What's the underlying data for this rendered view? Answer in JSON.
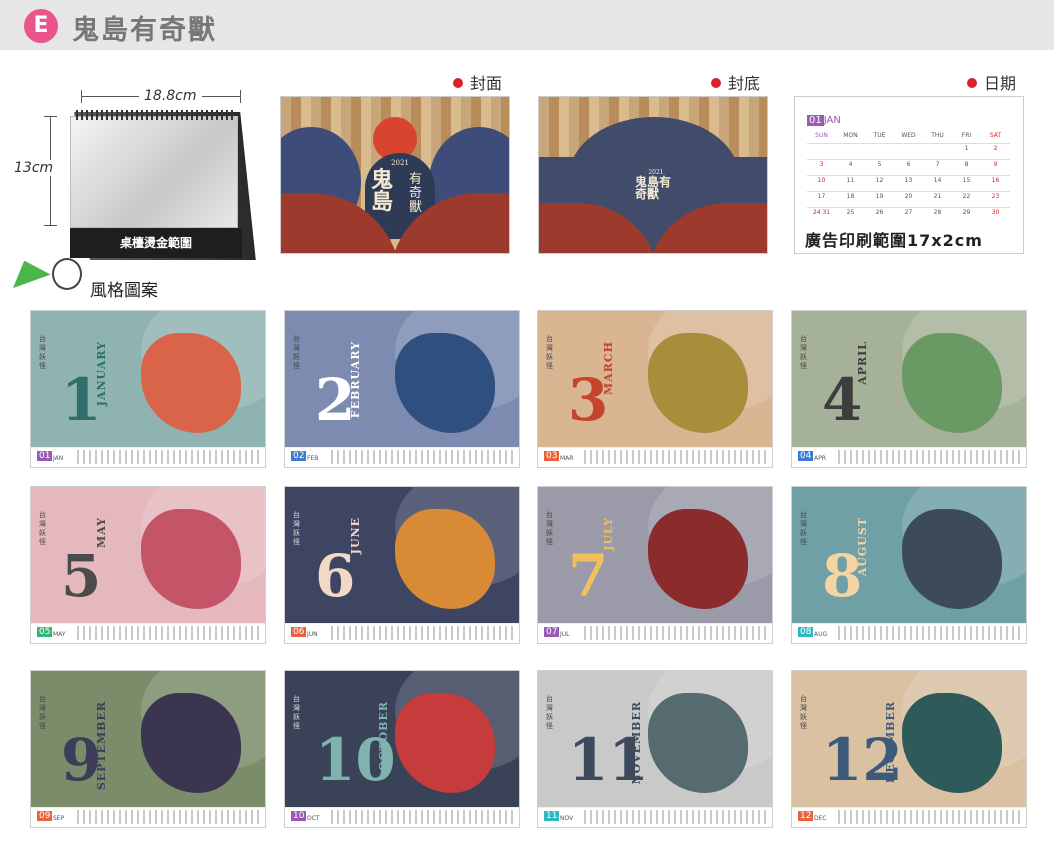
{
  "header": {
    "badge": "E",
    "title": "鬼島有奇獸"
  },
  "desk": {
    "width_label": "18.8cm",
    "height_label": "13cm",
    "base_label": "桌檯燙金範圍"
  },
  "cover": {
    "label": "封面",
    "year": "2021",
    "title_big": "鬼島",
    "title_small": "有奇獸"
  },
  "back_cover": {
    "label": "封底",
    "year": "2021",
    "title": "鬼島有奇獸"
  },
  "date_page": {
    "label": "日期",
    "month_num": "01",
    "month_abbr": "JAN",
    "weekdays": [
      "SUN",
      "MON",
      "TUE",
      "WED",
      "THU",
      "FRI",
      "SAT"
    ],
    "days": [
      "",
      "",
      "",
      "",
      "",
      "1",
      "2",
      "3",
      "4",
      "5",
      "6",
      "7",
      "8",
      "9",
      "10",
      "11",
      "12",
      "13",
      "14",
      "15",
      "16",
      "17",
      "18",
      "19",
      "20",
      "21",
      "22",
      "23",
      "24 31",
      "25",
      "26",
      "27",
      "28",
      "29",
      "30"
    ],
    "caption": "廣告印刷範圍17x2cm"
  },
  "style_label": "風格圖案",
  "months": [
    {
      "num": "1",
      "name": "JANUARY",
      "badge": "01",
      "abbr": "JAN",
      "bg": "#8fb3b0",
      "accent": "#2f6f6a",
      "creature": "#d9644a",
      "badge_color": "#9b59b6"
    },
    {
      "num": "2",
      "name": "FEBRUARY",
      "badge": "02",
      "abbr": "FEB",
      "bg": "#7d8bb0",
      "accent": "#ffffff",
      "creature": "#2f4f7f",
      "badge_color": "#3a7bd5"
    },
    {
      "num": "3",
      "name": "MARCH",
      "badge": "03",
      "abbr": "MAR",
      "bg": "#d9b592",
      "accent": "#c4452c",
      "creature": "#a88d3a",
      "badge_color": "#e8623c"
    },
    {
      "num": "4",
      "name": "APRIL",
      "badge": "04",
      "abbr": "APR",
      "bg": "#a6b199",
      "accent": "#3d3d3d",
      "creature": "#6a9a63",
      "badge_color": "#3a7bd5"
    },
    {
      "num": "5",
      "name": "MAY",
      "badge": "05",
      "abbr": "MAY",
      "bg": "#e4b8bd",
      "accent": "#4b4b4b",
      "creature": "#c45467",
      "badge_color": "#2eb873"
    },
    {
      "num": "6",
      "name": "JUNE",
      "badge": "06",
      "abbr": "JUN",
      "bg": "#3e4563",
      "accent": "#f1d9c5",
      "creature": "#d98a34",
      "badge_color": "#e8623c"
    },
    {
      "num": "7",
      "name": "JULY",
      "badge": "07",
      "abbr": "JUL",
      "bg": "#9a9aa8",
      "accent": "#f1c05c",
      "creature": "#8b2b2b",
      "badge_color": "#9b59b6"
    },
    {
      "num": "8",
      "name": "AUGUST",
      "badge": "08",
      "abbr": "AUG",
      "bg": "#6fa0a6",
      "accent": "#f4d4a4",
      "creature": "#3d4a5c",
      "badge_color": "#2eb8c4"
    },
    {
      "num": "9",
      "name": "SEPTEMBER",
      "badge": "09",
      "abbr": "SEP",
      "bg": "#7a8c6a",
      "accent": "#3d3d5a",
      "creature": "#3b3550",
      "badge_color": "#e8623c"
    },
    {
      "num": "10",
      "name": "OCTOBER",
      "badge": "10",
      "abbr": "OCT",
      "bg": "#3a4258",
      "accent": "#7fb3b0",
      "creature": "#c63b3b",
      "badge_color": "#9b59b6"
    },
    {
      "num": "11",
      "name": "NOVEMBER",
      "badge": "11",
      "abbr": "NOV",
      "bg": "#c9c9c9",
      "accent": "#3d4a5c",
      "creature": "#556b6f",
      "badge_color": "#2eb8c4"
    },
    {
      "num": "12",
      "name": "DECEMBER",
      "badge": "12",
      "abbr": "DEC",
      "bg": "#d9c1a2",
      "accent": "#3d5a7a",
      "creature": "#2f5a5a",
      "badge_color": "#e8623c"
    }
  ]
}
